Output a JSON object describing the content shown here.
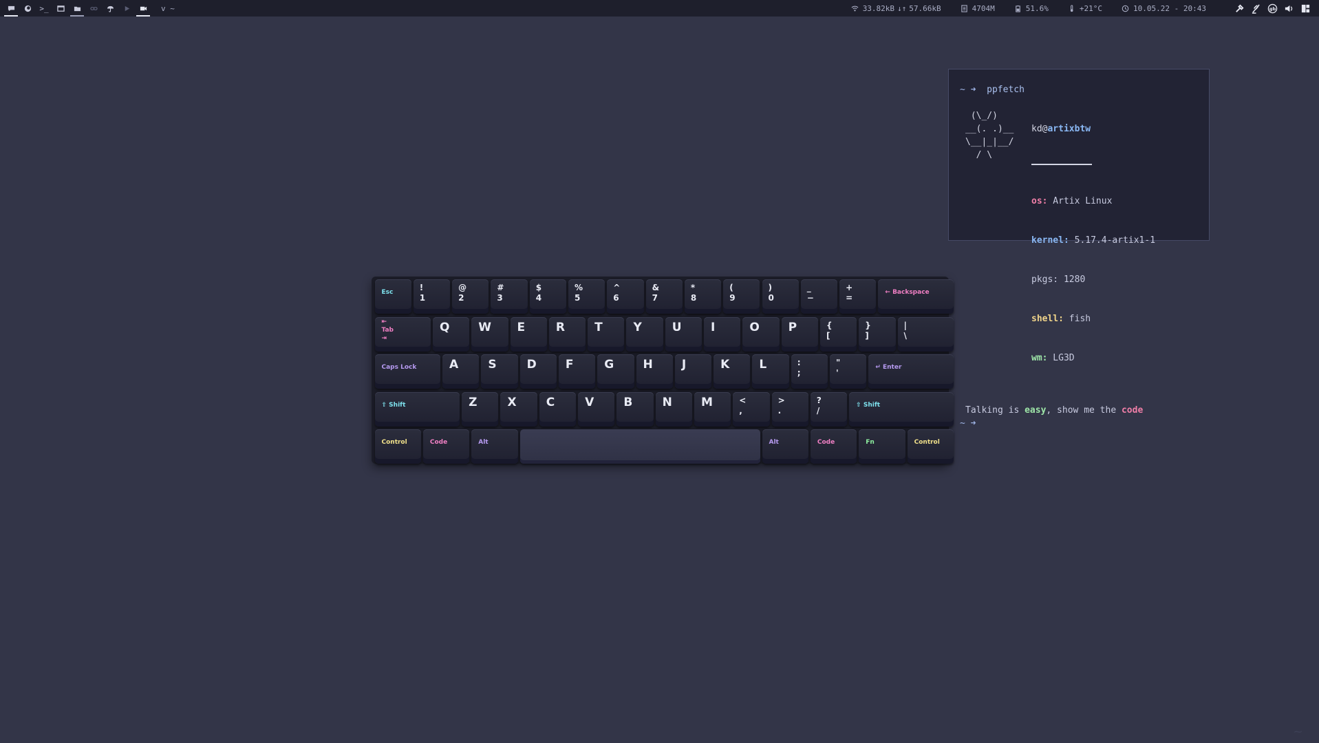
{
  "topbar": {
    "title": "v ~",
    "net": {
      "down": "33.82kB",
      "up": "57.66kB",
      "arrows": "↓↑"
    },
    "memory": "4704M",
    "battery": "51.6%",
    "temperature": "+21°C",
    "datetime": "10.05.22 - 20:43",
    "workspaces": [
      {
        "icon": "chat-icon",
        "state": "active"
      },
      {
        "icon": "firefox-icon",
        "state": "normal"
      },
      {
        "icon": "terminal-icon",
        "state": "normal"
      },
      {
        "icon": "window-icon",
        "state": "normal"
      },
      {
        "icon": "folder-icon",
        "state": "occupied"
      },
      {
        "icon": "link-icon",
        "state": "dim"
      },
      {
        "icon": "umbrella-icon",
        "state": "normal"
      },
      {
        "icon": "play-icon",
        "state": "dim"
      },
      {
        "icon": "video-icon",
        "state": "active"
      }
    ],
    "terminal_glyph": ">_"
  },
  "terminal": {
    "prompt": "~ ➜",
    "command": "ppfetch",
    "user": "kd",
    "at": "@",
    "host": "artixbtw",
    "ascii": [
      " (\\_/)",
      "__(. .)__",
      "\\__|_|__/",
      "  / \\"
    ],
    "fields": [
      {
        "key": "os:",
        "value": " Artix Linux"
      },
      {
        "key": "kernel:",
        "value": " 5.17.4-artix1-1"
      },
      {
        "key": "pkgs:",
        "value": " 1280"
      },
      {
        "key": "shell:",
        "value": " fish"
      },
      {
        "key": "wm:",
        "value": " LG3D"
      }
    ],
    "talk": {
      "p1": "Talking is ",
      "easy": "easy",
      "p2": ", show me the ",
      "code": "code"
    },
    "prompt2": "~ ➜"
  },
  "keyboard": {
    "row1": {
      "esc": "Esc",
      "keys": [
        [
          "!",
          "1"
        ],
        [
          "@",
          "2"
        ],
        [
          "#",
          "3"
        ],
        [
          "$",
          "4"
        ],
        [
          "%",
          "5"
        ],
        [
          "^",
          "6"
        ],
        [
          "&",
          "7"
        ],
        [
          "*",
          "8"
        ],
        [
          "(",
          "9"
        ],
        [
          ")",
          "0"
        ],
        [
          "_",
          "−"
        ],
        [
          "+",
          "="
        ]
      ],
      "backspace": "← Backspace"
    },
    "row2": {
      "tab": "Tab",
      "tab_arrow_left": "⇤",
      "tab_arrow_right": "⇥",
      "keys": [
        "Q",
        "W",
        "E",
        "R",
        "T",
        "Y",
        "U",
        "I",
        "O",
        "P"
      ],
      "brackets": [
        [
          "{",
          "["
        ],
        [
          "}",
          "]"
        ]
      ],
      "pipe": [
        "|",
        "\\"
      ]
    },
    "row3": {
      "caps": "Caps Lock",
      "keys": [
        "A",
        "S",
        "D",
        "F",
        "G",
        "H",
        "J",
        "K",
        "L"
      ],
      "punct": [
        [
          ":",
          ";"
        ],
        [
          "\"",
          "'"
        ]
      ],
      "enter": "↵ Enter"
    },
    "row4": {
      "shift_l": "⇧ Shift",
      "keys": [
        "Z",
        "X",
        "C",
        "V",
        "B",
        "N",
        "M"
      ],
      "punct": [
        [
          "<",
          ","
        ],
        [
          ">",
          "."
        ],
        [
          "?",
          "/"
        ]
      ],
      "shift_r": "⇧ Shift"
    },
    "row5": {
      "ctrl_l": "Control",
      "code_l": "Code",
      "alt_l": "Alt",
      "alt_r": "Alt",
      "code_r": "Code",
      "fn": "Fn",
      "ctrl_r": "Control"
    }
  },
  "colors": {
    "background": "#333548",
    "bar": "#1e1f2c",
    "terminal": "#222334",
    "cyan": "#7ee2ee",
    "pink": "#f07fc4",
    "purple": "#b69af0",
    "yellow": "#f0e08a",
    "green": "#8ef0a0"
  }
}
